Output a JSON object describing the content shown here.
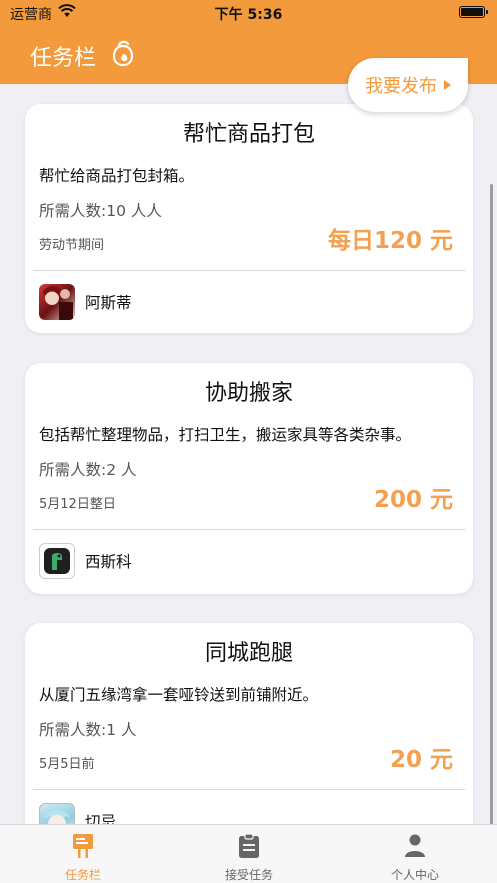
{
  "status_bar": {
    "carrier": "运营商",
    "time": "下午 5:36"
  },
  "nav": {
    "title": "任务栏",
    "publish_label": "我要发布"
  },
  "tasks": [
    {
      "title": "帮忙商品打包",
      "description": "帮忙给商品打包封箱。",
      "people": "所需人数:10 人人",
      "time": "劳动节期间",
      "price": "每日120 元",
      "user": "阿斯蒂"
    },
    {
      "title": "协助搬家",
      "description": "包括帮忙整理物品，打扫卫生，搬运家具等各类杂事。",
      "people": "所需人数:2 人",
      "time": "5月12日整日",
      "price": "200 元",
      "user": "西斯科"
    },
    {
      "title": "同城跑腿",
      "description": "从厦门五缘湾拿一套哑铃送到前铺附近。",
      "people": "所需人数:1 人",
      "time": "5月5日前",
      "price": "20 元",
      "user": "切忌"
    }
  ],
  "tabs": [
    {
      "label": "任务栏",
      "icon": "signboard-icon",
      "active": true
    },
    {
      "label": "接受任务",
      "icon": "clipboard-icon",
      "active": false
    },
    {
      "label": "个人中心",
      "icon": "person-icon",
      "active": false
    }
  ],
  "colors": {
    "accent": "#f39a3c",
    "price": "#f3a050",
    "background": "#efeff4",
    "tab_inactive": "#666666"
  }
}
